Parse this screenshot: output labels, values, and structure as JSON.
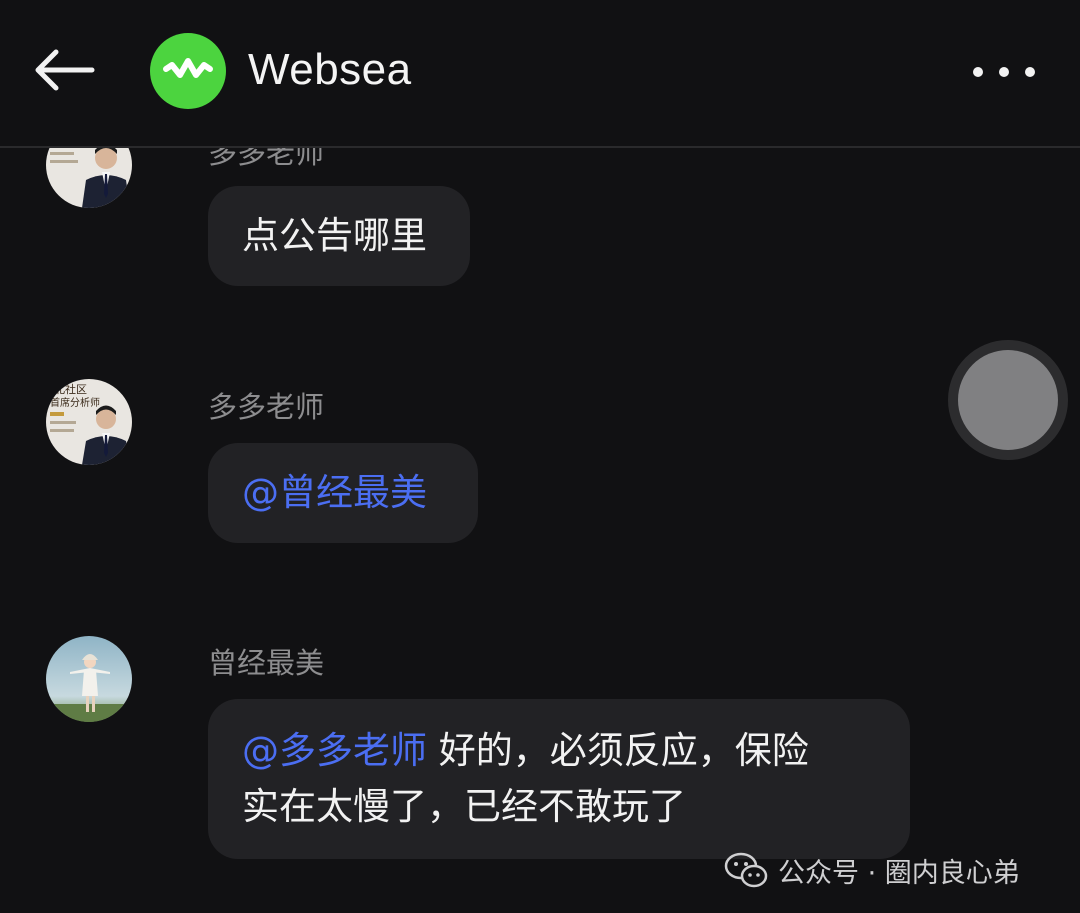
{
  "header": {
    "title": "Websea",
    "back_icon": "arrow-left-icon",
    "menu_icon": "more-horizontal-icon",
    "logo_color": "#4cd43f"
  },
  "messages": [
    {
      "sender": "多多老师",
      "text": "点公告哪里"
    },
    {
      "sender": "多多老师",
      "avatar_caption": "北社区\n首席分析师",
      "mention": "@曾经最美"
    },
    {
      "sender": "曾经最美",
      "mention": "@多多老师",
      "text_line1": " 好的，必须反应，保险",
      "text_line2": "实在太慢了，已经不敢玩了"
    }
  ],
  "watermark": {
    "text": "公众号 · 圈内良心弟",
    "icon": "wechat-icon"
  },
  "colors": {
    "background": "#111113",
    "bubble": "#222225",
    "mention": "#4b6ef2",
    "sender": "#8d8d8f"
  }
}
